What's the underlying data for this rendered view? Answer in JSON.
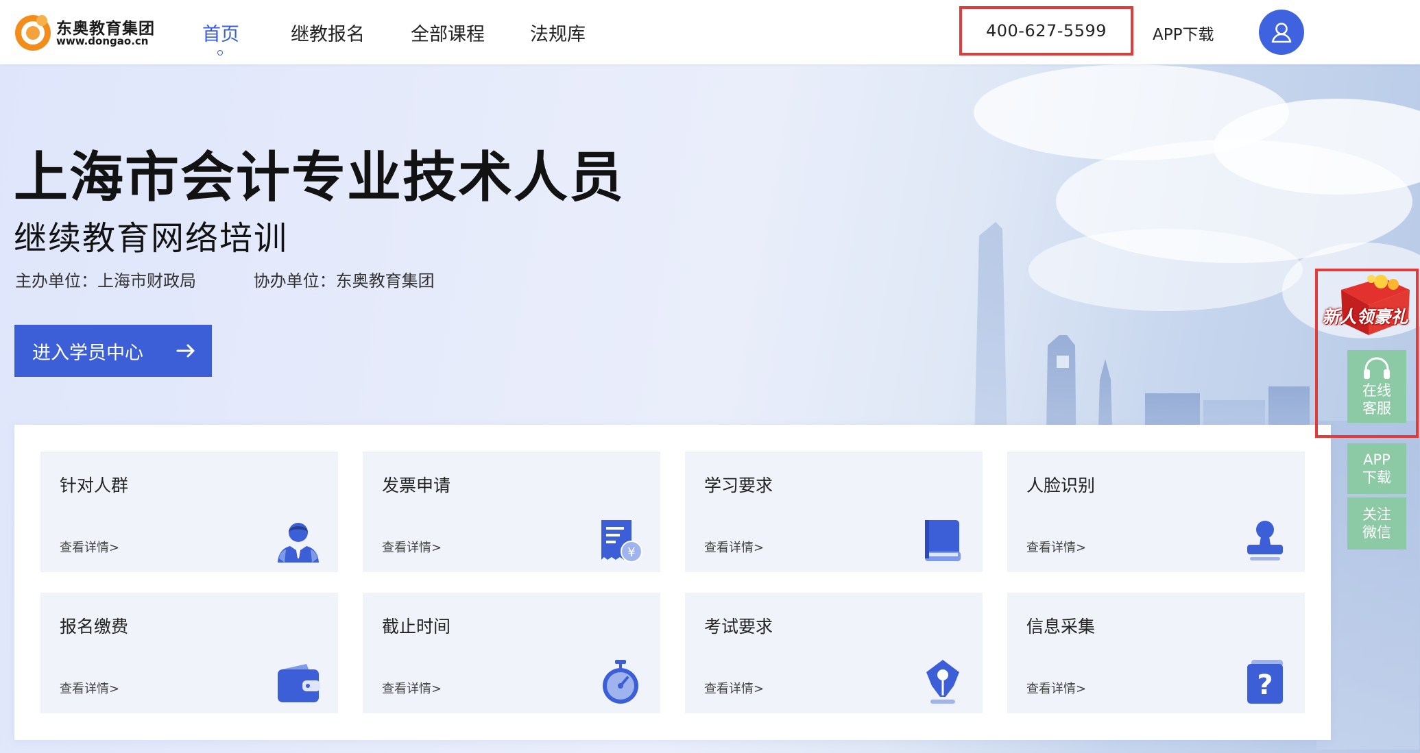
{
  "header": {
    "logo": {
      "name": "东奥教育集团",
      "url": "www.dongao.cn"
    },
    "nav": [
      {
        "label": "首页",
        "active": true
      },
      {
        "label": "继教报名",
        "active": false
      },
      {
        "label": "全部课程",
        "active": false
      },
      {
        "label": "法规库",
        "active": false
      }
    ],
    "phone": "400-627-5599",
    "app_download": "APP下载",
    "avatar_icon": "user-icon"
  },
  "hero": {
    "title": "上海市会计专业技术人员",
    "subtitle": "继续教育网络培训",
    "host": "主办单位：上海市财政局",
    "co_host": "协办单位：东奥教育集团",
    "enter_button": "进入学员中心"
  },
  "cards": [
    {
      "title": "针对人群",
      "link": "查看详情>",
      "icon": "people-icon"
    },
    {
      "title": "发票申请",
      "link": "查看详情>",
      "icon": "invoice-icon"
    },
    {
      "title": "学习要求",
      "link": "查看详情>",
      "icon": "book-icon"
    },
    {
      "title": "人脸识别",
      "link": "查看详情>",
      "icon": "stamp-icon"
    },
    {
      "title": "报名缴费",
      "link": "查看详情>",
      "icon": "wallet-icon"
    },
    {
      "title": "截止时间",
      "link": "查看详情>",
      "icon": "stopwatch-icon"
    },
    {
      "title": "考试要求",
      "link": "查看详情>",
      "icon": "pen-nib-icon"
    },
    {
      "title": "信息采集",
      "link": "查看详情>",
      "icon": "question-icon"
    }
  ],
  "sidebar": {
    "promo": "新人领豪礼",
    "service": "在线客服",
    "app": "APP下载",
    "wechat": "关注微信"
  },
  "colors": {
    "accent": "#3c5fd8",
    "highlight_border": "#e33a3a",
    "sidebar_green": "#8cc9a5",
    "card_bg": "#f1f3fa"
  }
}
